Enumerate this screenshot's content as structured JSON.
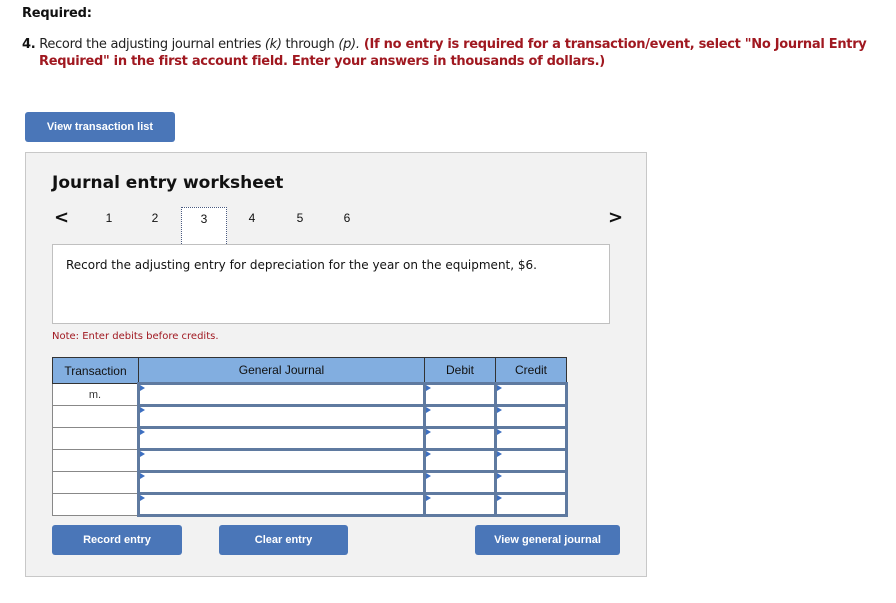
{
  "required_label": "Required:",
  "instruction": {
    "number": "4.",
    "text_before": " Record the adjusting journal entries ",
    "k": "(k)",
    "through": " through ",
    "p": "(p).",
    "red_line1": " (If no entry is required for a transaction/event, select \"No Journal Entry",
    "red_line2": "Required\" in the first account field. Enter your answers in thousands of dollars.)"
  },
  "buttons": {
    "view_transaction_list": "View transaction list",
    "record_entry": "Record entry",
    "clear_entry": "Clear entry",
    "view_general_journal": "View general journal"
  },
  "worksheet": {
    "title": "Journal entry worksheet",
    "prev_icon": "<",
    "next_icon": ">",
    "tabs": [
      "1",
      "2",
      "3",
      "4",
      "5",
      "6"
    ],
    "active_tab": "3",
    "description": "Record the adjusting entry for depreciation for the year on the equipment, $6.",
    "note": "Note: Enter debits before credits."
  },
  "table": {
    "headers": [
      "Transaction",
      "General Journal",
      "Debit",
      "Credit"
    ],
    "rows": [
      {
        "transaction": "m.",
        "account": "",
        "debit": "",
        "credit": ""
      },
      {
        "transaction": "",
        "account": "",
        "debit": "",
        "credit": ""
      },
      {
        "transaction": "",
        "account": "",
        "debit": "",
        "credit": ""
      },
      {
        "transaction": "",
        "account": "",
        "debit": "",
        "credit": ""
      },
      {
        "transaction": "",
        "account": "",
        "debit": "",
        "credit": ""
      },
      {
        "transaction": "",
        "account": "",
        "debit": "",
        "credit": ""
      }
    ]
  },
  "colors": {
    "button_blue": "#4a76b8",
    "header_blue": "#82aee0",
    "instruction_red": "#a01820"
  }
}
